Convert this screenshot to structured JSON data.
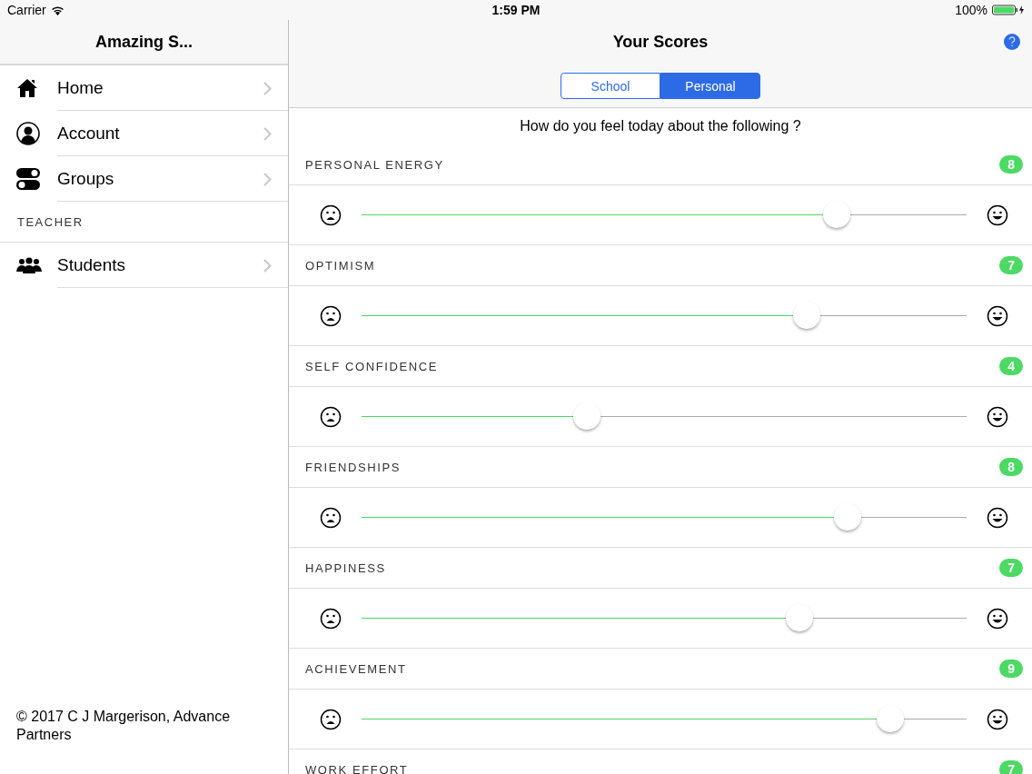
{
  "status_bar": {
    "carrier": "Carrier",
    "time": "1:59 PM",
    "battery": "100%"
  },
  "sidebar": {
    "title": "Amazing S...",
    "items": [
      {
        "label": "Home"
      },
      {
        "label": "Account"
      },
      {
        "label": "Groups"
      }
    ],
    "sections": [
      {
        "header": "TEACHER",
        "items": [
          {
            "label": "Students"
          }
        ]
      }
    ],
    "footer": "© 2017 C J Margerison, Advance Partners"
  },
  "main": {
    "title": "Your Scores",
    "tabs": [
      {
        "label": "School",
        "selected": false
      },
      {
        "label": "Personal",
        "selected": true
      }
    ],
    "question": "How do you feel today about the following ?",
    "scores": [
      {
        "name": "PERSONAL ENERGY",
        "value": "8",
        "level": 0.786
      },
      {
        "name": "OPTIMISM",
        "value": "7",
        "level": 0.736
      },
      {
        "name": "SELF CONFIDENCE",
        "value": "4",
        "level": 0.373
      },
      {
        "name": "FRIENDSHIPS",
        "value": "8",
        "level": 0.804
      },
      {
        "name": "HAPPINESS",
        "value": "7",
        "level": 0.723
      },
      {
        "name": "ACHIEVEMENT",
        "value": "9",
        "level": 0.874
      },
      {
        "name": "WORK EFFORT",
        "value": "7"
      }
    ]
  }
}
